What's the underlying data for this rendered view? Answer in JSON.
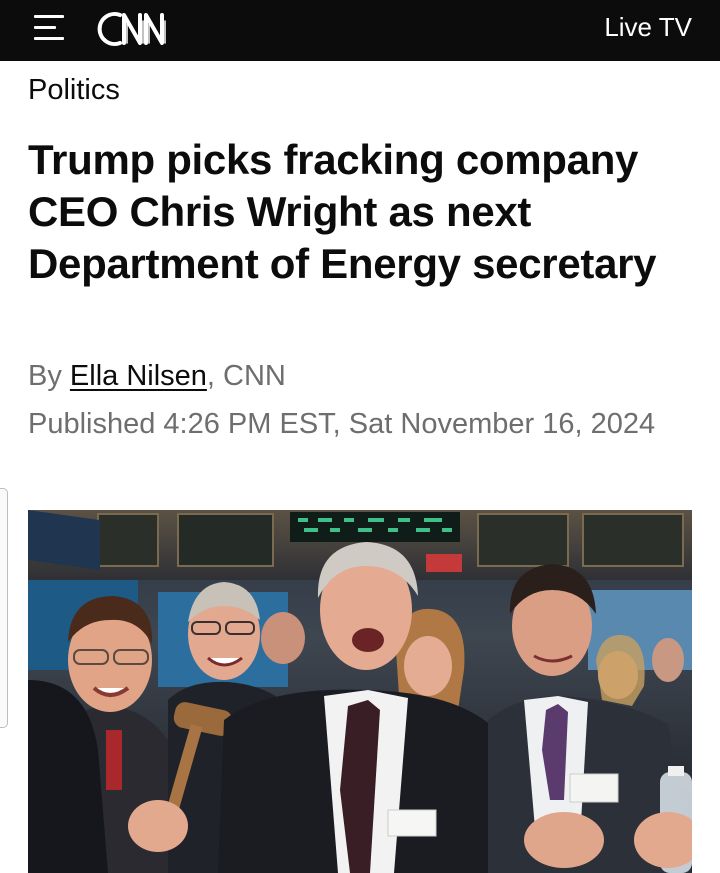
{
  "header": {
    "logo_text": "CNN",
    "menu_icon": "hamburger-menu-icon",
    "live_tv_label": "Live TV"
  },
  "article": {
    "section": "Politics",
    "headline": "Trump picks fracking company CEO Chris Wright as next Department of Energy secretary",
    "byline_prefix": "By",
    "author": "Ella Nilsen",
    "outlet": ", CNN",
    "published": "Published 4:26 PM EST, Sat November 16, 2024"
  },
  "photo": {
    "subject": "photo-of-men-celebrating-at-stock-exchange"
  },
  "colors": {
    "topbar": "#0c0c0c",
    "headline": "#0c0c0c",
    "meta_text": "#6e6e6e"
  }
}
